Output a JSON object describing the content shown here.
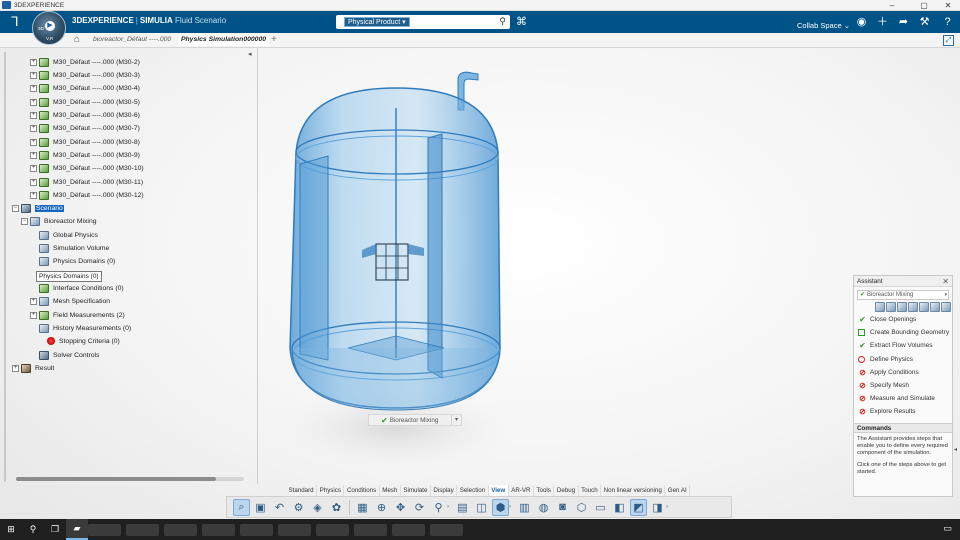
{
  "window": {
    "title": "3DEXPERIENCE",
    "controls": [
      "–",
      "▢",
      "✕"
    ]
  },
  "topbar": {
    "brand": "3DEXPERIENCE",
    "product": "SIMULIA",
    "app": "Fluid Scenario",
    "search_scope": "Physical Product ▾",
    "search_placeholder": "",
    "collab_space": "Collab Space",
    "icons": [
      "user-icon",
      "plus-icon",
      "share-icon",
      "tools-icon",
      "help-icon"
    ]
  },
  "compass": {
    "label": "V,R",
    "num": "3D"
  },
  "tabs": {
    "home_icon": "home-icon",
    "items": [
      {
        "label": "bioreactor_Défaut ----.000",
        "active": false
      },
      {
        "label": "Physics Simulation000000",
        "active": true
      }
    ],
    "add": "+"
  },
  "tree": {
    "parts": [
      "M30_Défaut ----.000 (M30-2)",
      "M30_Défaut ----.000 (M30-3)",
      "M30_Défaut ----.000 (M30-4)",
      "M30_Défaut ----.000 (M30-5)",
      "M30_Défaut ----.000 (M30-6)",
      "M30_Défaut ----.000 (M30-7)",
      "M30_Défaut ----.000 (M30-8)",
      "M30_Défaut ----.000 (M30-9)",
      "M30_Défaut ----.000 (M30-10)",
      "M30_Défaut ----.000 (M30-11)",
      "M30_Défaut ----.000 (M30-12)"
    ],
    "scenario": "Scenario",
    "bioreactor": "Bioreactor Mixing",
    "global_physics": "Global Physics",
    "simulation_volume": "Simulation Volume",
    "physics_domains": "Physics Domains (0)",
    "interface_conditions": "Interface Conditions (0)",
    "mesh_specification": "Mesh Specification",
    "field_measurements": "Field Measurements (2)",
    "history_measurements": "History Measurements (0)",
    "stopping_criteria": "Stopping Criteria (0)",
    "solver_controls": "Solver Controls",
    "result": "Result",
    "tooltip": "Physics Domains (0)"
  },
  "viewport": {
    "object_label": "Bioreactor Mixing"
  },
  "assistant": {
    "title": "Assistant",
    "selected": "Bioreactor Mixing",
    "steps": [
      {
        "label": "Close Openings",
        "status": "done"
      },
      {
        "label": "Create Bounding Geometry",
        "status": "optional"
      },
      {
        "label": "Extract Flow Volumes",
        "status": "done"
      },
      {
        "label": "Define Physics",
        "status": "todo"
      },
      {
        "label": "Apply Conditions",
        "status": "blocked"
      },
      {
        "label": "Specify Mesh",
        "status": "blocked"
      },
      {
        "label": "Measure and Simulate",
        "status": "blocked"
      },
      {
        "label": "Explore Results",
        "status": "blocked"
      }
    ],
    "commands_title": "Commands",
    "commands_text_1": "The Assistant provides steps that enable you to define every required component of the simulation.",
    "commands_text_2": "Click one of the steps above to get started."
  },
  "action_bar": {
    "tabs": [
      "Standard",
      "Physics",
      "Conditions",
      "Mesh",
      "Simulate",
      "Display",
      "Selection",
      "View",
      "AR-VR",
      "Tools",
      "Debug",
      "Touch",
      "Non linear versioning",
      "Gen AI"
    ],
    "active": "View"
  },
  "colors": {
    "topbar": "#005386",
    "tank_blue": "#3e8fd0",
    "selection": "#1467c4"
  }
}
